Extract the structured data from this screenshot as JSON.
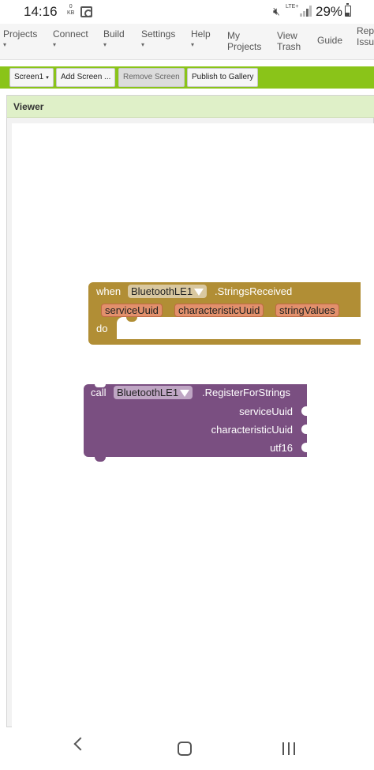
{
  "status_bar": {
    "time": "14:16",
    "net_speed": "0\nKB",
    "network": "LTE+",
    "battery": "29%"
  },
  "menu": {
    "items": [
      {
        "label": "Projects",
        "arrow": "▾"
      },
      {
        "label": "Connect",
        "arrow": "▾"
      },
      {
        "label": "Build",
        "arrow": "▾"
      },
      {
        "label": "Settings",
        "arrow": "▾"
      },
      {
        "label": "Help",
        "arrow": "▾"
      },
      {
        "label": "My\nProjects"
      },
      {
        "label": "View\nTrash"
      },
      {
        "label": "Guide"
      },
      {
        "label": "Repo\nIssu"
      }
    ]
  },
  "toolbar": {
    "screen_label": "Screen1",
    "add_screen_label": "Add Screen ...",
    "remove_screen_label": "Remove Screen",
    "publish_label": "Publish to Gallery"
  },
  "viewer": {
    "title": "Viewer"
  },
  "event_block": {
    "keyword": "when",
    "component": "BluetoothLE1",
    "event": ".StringsReceived",
    "params": [
      "serviceUuid",
      "characteristicUuid",
      "stringValues"
    ],
    "do_label": "do",
    "color": "#b18e35"
  },
  "call_block": {
    "keyword": "call",
    "component": "BluetoothLE1",
    "method": ".RegisterForStrings",
    "args": [
      "serviceUuid",
      "characteristicUuid",
      "utf16"
    ],
    "color": "#7a4f81"
  },
  "nav": {
    "back_icon": "chevron-left-icon",
    "home_icon": "home-icon",
    "recents_icon": "recents-icon"
  }
}
